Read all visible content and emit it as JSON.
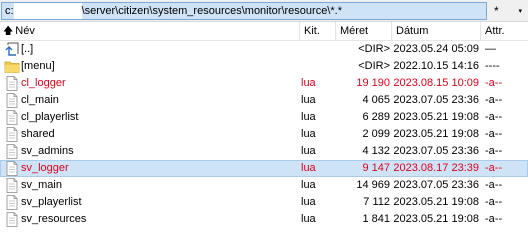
{
  "path": {
    "drive": "c:",
    "text": "\\server\\citizen\\system_resources\\monitor\\resource\\*.*",
    "filter_label": "*",
    "filter_chevron": "▾"
  },
  "columns": {
    "name": "Név",
    "ext": "Kit.",
    "size": "Méret",
    "date": "Dátum",
    "attr": "Attr."
  },
  "sort_icon": "arrow-up-icon",
  "rows": [
    {
      "icon": "up-folder-icon",
      "name": "[..]",
      "ext": "",
      "size": "<DIR>",
      "date": "2023.05.24 05:09",
      "attr": "—",
      "style": "normal"
    },
    {
      "icon": "folder-icon",
      "name": "[menu]",
      "ext": "",
      "size": "<DIR>",
      "date": "2022.10.15 14:16",
      "attr": "----",
      "style": "normal"
    },
    {
      "icon": "file-icon",
      "name": "cl_logger",
      "ext": "lua",
      "size": "19 190",
      "date": "2023.08.15 10:09",
      "attr": "-a--",
      "style": "red"
    },
    {
      "icon": "file-icon",
      "name": "cl_main",
      "ext": "lua",
      "size": "4 065",
      "date": "2023.07.05 23:36",
      "attr": "-a--",
      "style": "normal"
    },
    {
      "icon": "file-icon",
      "name": "cl_playerlist",
      "ext": "lua",
      "size": "6 289",
      "date": "2023.05.21 19:08",
      "attr": "-a--",
      "style": "normal"
    },
    {
      "icon": "file-icon",
      "name": "shared",
      "ext": "lua",
      "size": "2 099",
      "date": "2023.05.21 19:08",
      "attr": "-a--",
      "style": "normal"
    },
    {
      "icon": "file-icon",
      "name": "sv_admins",
      "ext": "lua",
      "size": "4 132",
      "date": "2023.07.05 23:36",
      "attr": "-a--",
      "style": "normal"
    },
    {
      "icon": "file-icon",
      "name": "sv_logger",
      "ext": "lua",
      "size": "9 147",
      "date": "2023.08.17 23:39",
      "attr": "-a--",
      "style": "red selected"
    },
    {
      "icon": "file-icon",
      "name": "sv_main",
      "ext": "lua",
      "size": "14 969",
      "date": "2023.07.05 23:36",
      "attr": "-a--",
      "style": "normal"
    },
    {
      "icon": "file-icon",
      "name": "sv_playerlist",
      "ext": "lua",
      "size": "7 112",
      "date": "2023.05.21 19:08",
      "attr": "-a--",
      "style": "normal"
    },
    {
      "icon": "file-icon",
      "name": "sv_resources",
      "ext": "lua",
      "size": "1 841",
      "date": "2023.05.21 19:08",
      "attr": "-a--",
      "style": "normal"
    }
  ],
  "colors": {
    "highlight_text": "#e0001b",
    "selection_bg": "#cfe3f7",
    "folder": "#f2c94c"
  }
}
